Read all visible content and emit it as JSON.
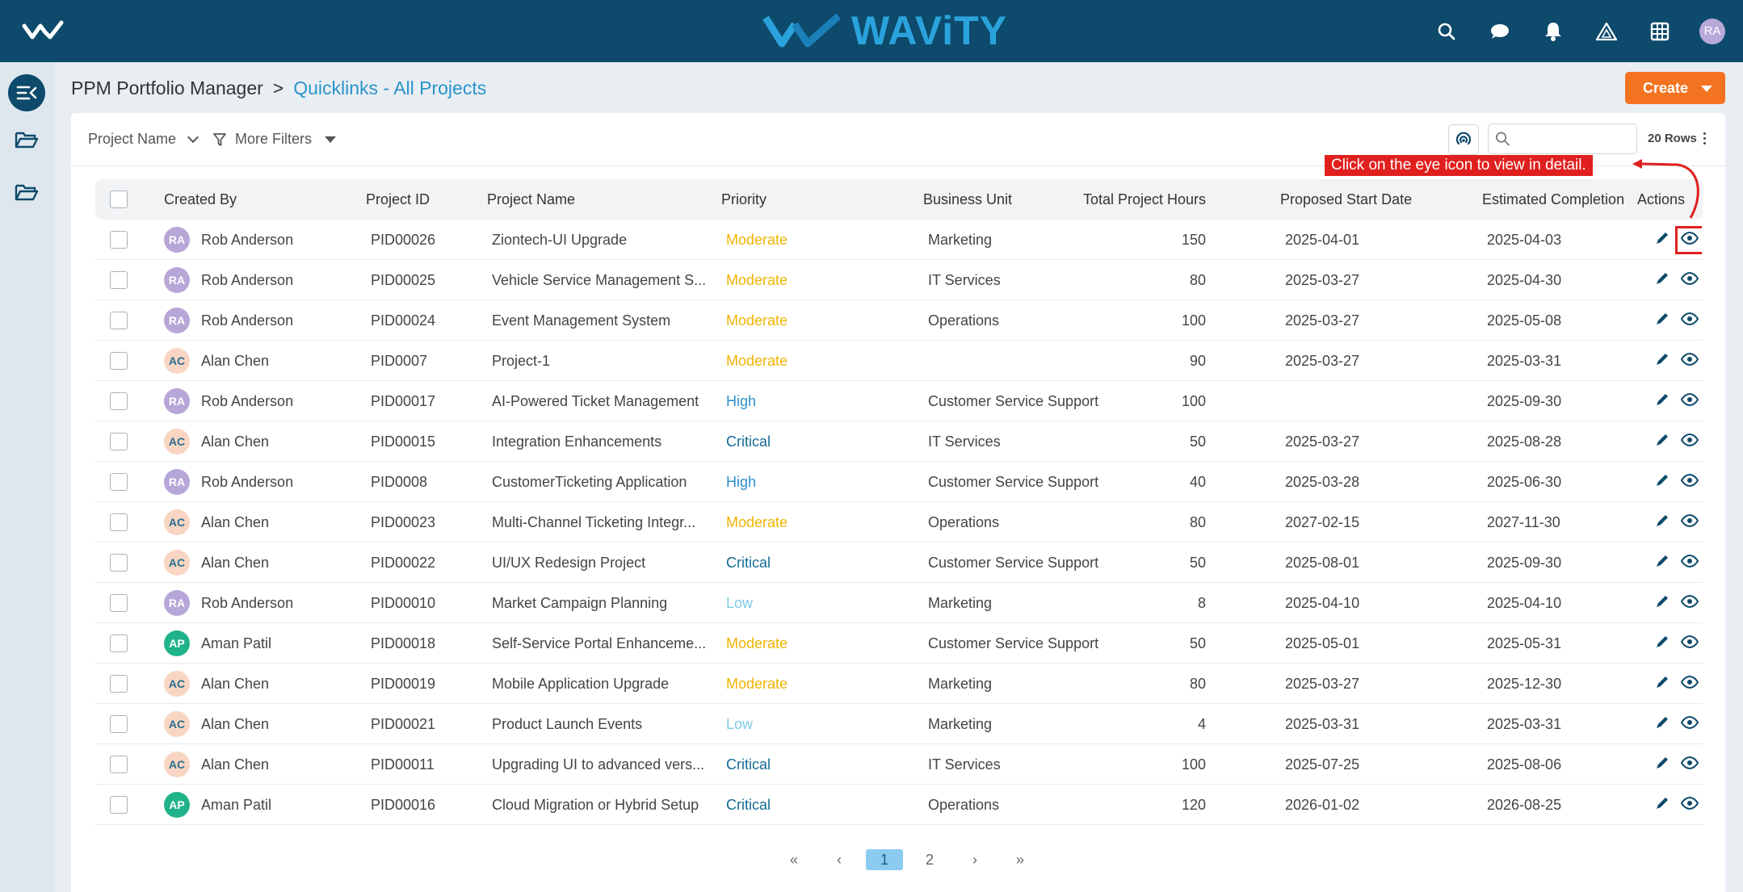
{
  "topbar": {
    "brand": "WAViTY",
    "avatar_initials": "RA",
    "icons": [
      "search-icon",
      "chat-icon",
      "bell-icon",
      "alert-triangle-icon",
      "grid-icon"
    ]
  },
  "header": {
    "crumb_root": "PPM Portfolio Manager",
    "crumb_sep": ">",
    "crumb_current": "Quicklinks - All Projects",
    "create_label": "Create"
  },
  "filters": {
    "project_name": "Project Name",
    "more_filters": "More Filters",
    "search_placeholder": "",
    "rows_label": "20 Rows"
  },
  "annotation": {
    "text": "Click on the eye icon to view in detail."
  },
  "table": {
    "columns": [
      "Created By",
      "Project ID",
      "Project Name",
      "Priority",
      "Business Unit",
      "Total Project Hours",
      "Proposed Start Date",
      "Estimated Completion",
      "Actions"
    ],
    "rows": [
      {
        "initials": "RA",
        "created_by": "Rob Anderson",
        "id": "PID00026",
        "name": "Ziontech-UI Upgrade",
        "priority": "Moderate",
        "unit": "Marketing",
        "hours": "150",
        "start": "2025-04-01",
        "end": "2025-04-03"
      },
      {
        "initials": "RA",
        "created_by": "Rob Anderson",
        "id": "PID00025",
        "name": "Vehicle Service Management S...",
        "priority": "Moderate",
        "unit": "IT Services",
        "hours": "80",
        "start": "2025-03-27",
        "end": "2025-04-30"
      },
      {
        "initials": "RA",
        "created_by": "Rob Anderson",
        "id": "PID00024",
        "name": "Event Management System",
        "priority": "Moderate",
        "unit": "Operations",
        "hours": "100",
        "start": "2025-03-27",
        "end": "2025-05-08"
      },
      {
        "initials": "AC",
        "created_by": "Alan Chen",
        "id": "PID0007",
        "name": "Project-1",
        "priority": "Moderate",
        "unit": "",
        "hours": "90",
        "start": "2025-03-27",
        "end": "2025-03-31"
      },
      {
        "initials": "RA",
        "created_by": "Rob Anderson",
        "id": "PID00017",
        "name": "AI-Powered Ticket Management",
        "priority": "High",
        "unit": "Customer Service Support",
        "hours": "100",
        "start": "",
        "end": "2025-09-30"
      },
      {
        "initials": "AC",
        "created_by": "Alan Chen",
        "id": "PID00015",
        "name": "Integration Enhancements",
        "priority": "Critical",
        "unit": "IT Services",
        "hours": "50",
        "start": "2025-03-27",
        "end": "2025-08-28"
      },
      {
        "initials": "RA",
        "created_by": "Rob Anderson",
        "id": "PID0008",
        "name": "CustomerTicketing Application",
        "priority": "High",
        "unit": "Customer Service Support",
        "hours": "40",
        "start": "2025-03-28",
        "end": "2025-06-30"
      },
      {
        "initials": "AC",
        "created_by": "Alan Chen",
        "id": "PID00023",
        "name": "Multi-Channel Ticketing Integr...",
        "priority": "Moderate",
        "unit": "Operations",
        "hours": "80",
        "start": "2027-02-15",
        "end": "2027-11-30"
      },
      {
        "initials": "AC",
        "created_by": "Alan Chen",
        "id": "PID00022",
        "name": "UI/UX Redesign Project",
        "priority": "Critical",
        "unit": "Customer Service Support",
        "hours": "50",
        "start": "2025-08-01",
        "end": "2025-09-30"
      },
      {
        "initials": "RA",
        "created_by": "Rob Anderson",
        "id": "PID00010",
        "name": "Market Campaign Planning",
        "priority": "Low",
        "unit": "Marketing",
        "hours": "8",
        "start": "2025-04-10",
        "end": "2025-04-10"
      },
      {
        "initials": "AP",
        "created_by": "Aman Patil",
        "id": "PID00018",
        "name": "Self-Service Portal Enhanceme...",
        "priority": "Moderate",
        "unit": "Customer Service Support",
        "hours": "50",
        "start": "2025-05-01",
        "end": "2025-05-31"
      },
      {
        "initials": "AC",
        "created_by": "Alan Chen",
        "id": "PID00019",
        "name": "Mobile Application Upgrade",
        "priority": "Moderate",
        "unit": "Marketing",
        "hours": "80",
        "start": "2025-03-27",
        "end": "2025-12-30"
      },
      {
        "initials": "AC",
        "created_by": "Alan Chen",
        "id": "PID00021",
        "name": "Product Launch Events",
        "priority": "Low",
        "unit": "Marketing",
        "hours": "4",
        "start": "2025-03-31",
        "end": "2025-03-31"
      },
      {
        "initials": "AC",
        "created_by": "Alan Chen",
        "id": "PID00011",
        "name": "Upgrading UI to advanced vers...",
        "priority": "Critical",
        "unit": "IT Services",
        "hours": "100",
        "start": "2025-07-25",
        "end": "2025-08-06"
      },
      {
        "initials": "AP",
        "created_by": "Aman Patil",
        "id": "PID00016",
        "name": "Cloud Migration or Hybrid Setup",
        "priority": "Critical",
        "unit": "Operations",
        "hours": "120",
        "start": "2026-01-02",
        "end": "2026-08-25"
      }
    ]
  },
  "colors": {
    "priority": {
      "Moderate": "#f0b400",
      "High": "#2a8fc7",
      "Critical": "#146c94",
      "Low": "#7ecbe8"
    },
    "avatar": {
      "RA": {
        "bg": "#b7a7d8",
        "fg": "#ffffff"
      },
      "AC": {
        "bg": "#f8d6c3",
        "fg": "#2a6f8f"
      },
      "AP": {
        "bg": "#20b38a",
        "fg": "#ffffff"
      }
    }
  },
  "pagination": {
    "first": "«",
    "prev": "‹",
    "pages": [
      "1",
      "2"
    ],
    "current": "1",
    "next": "›",
    "last": "»"
  }
}
